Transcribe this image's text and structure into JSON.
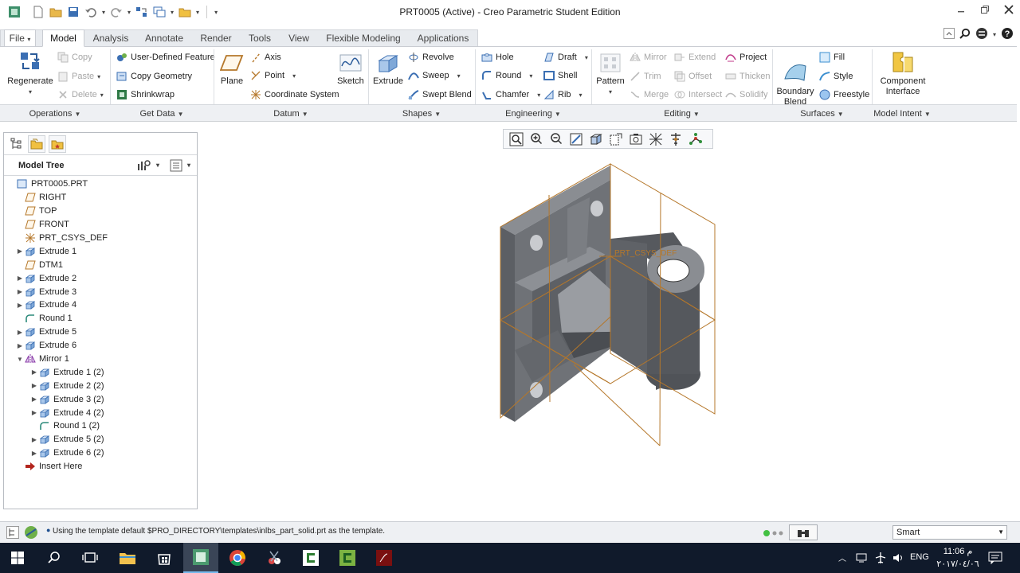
{
  "window": {
    "title": "PRT0005 (Active) - Creo Parametric Student Edition"
  },
  "tabs": [
    {
      "label": "File",
      "suffix": "▾"
    },
    {
      "label": "Model"
    },
    {
      "label": "Analysis"
    },
    {
      "label": "Annotate"
    },
    {
      "label": "Render"
    },
    {
      "label": "Tools"
    },
    {
      "label": "View"
    },
    {
      "label": "Flexible Modeling"
    },
    {
      "label": "Applications"
    }
  ],
  "ribbon": {
    "operations": {
      "regenerate": "Regenerate",
      "copy": "Copy",
      "paste": "Paste",
      "delete": "Delete",
      "group": "Operations"
    },
    "getdata": {
      "udf": "User-Defined Feature",
      "copy_geometry": "Copy Geometry",
      "shrinkwrap": "Shrinkwrap",
      "group": "Get Data"
    },
    "datum": {
      "plane": "Plane",
      "axis": "Axis",
      "point": "Point",
      "csys": "Coordinate System",
      "sketch": "Sketch",
      "group": "Datum"
    },
    "shapes": {
      "extrude": "Extrude",
      "revolve": "Revolve",
      "sweep": "Sweep",
      "swept_blend": "Swept Blend",
      "group": "Shapes"
    },
    "engineering": {
      "hole": "Hole",
      "round": "Round",
      "chamfer": "Chamfer",
      "draft": "Draft",
      "shell": "Shell",
      "rib": "Rib",
      "group": "Engineering"
    },
    "editing": {
      "pattern": "Pattern",
      "mirror": "Mirror",
      "trim": "Trim",
      "merge": "Merge",
      "extend": "Extend",
      "offset": "Offset",
      "intersect": "Intersect",
      "project": "Project",
      "thicken": "Thicken",
      "solidify": "Solidify",
      "group": "Editing"
    },
    "surfaces": {
      "boundary_blend": "Boundary\nBlend",
      "fill": "Fill",
      "style": "Style",
      "freestyle": "Freestyle",
      "group": "Surfaces"
    },
    "modelintent": {
      "component_interface": "Component\nInterface",
      "group": "Model Intent"
    }
  },
  "model_tree": {
    "title": "Model Tree",
    "items": [
      {
        "label": "PRT0005.PRT",
        "icon": "part-icon",
        "level": 0,
        "expander": ""
      },
      {
        "label": "RIGHT",
        "icon": "datum-plane-icon",
        "level": 1,
        "expander": ""
      },
      {
        "label": "TOP",
        "icon": "datum-plane-icon",
        "level": 1,
        "expander": ""
      },
      {
        "label": "FRONT",
        "icon": "datum-plane-icon",
        "level": 1,
        "expander": ""
      },
      {
        "label": "PRT_CSYS_DEF",
        "icon": "csys-icon",
        "level": 1,
        "expander": ""
      },
      {
        "label": "Extrude 1",
        "icon": "extrude-icon",
        "level": 1,
        "expander": "▶"
      },
      {
        "label": "DTM1",
        "icon": "datum-plane-icon",
        "level": 1,
        "expander": ""
      },
      {
        "label": "Extrude 2",
        "icon": "extrude-icon",
        "level": 1,
        "expander": "▶"
      },
      {
        "label": "Extrude 3",
        "icon": "extrude-icon",
        "level": 1,
        "expander": "▶"
      },
      {
        "label": "Extrude 4",
        "icon": "extrude-icon",
        "level": 1,
        "expander": "▶"
      },
      {
        "label": "Round 1",
        "icon": "round-icon",
        "level": 1,
        "expander": ""
      },
      {
        "label": "Extrude 5",
        "icon": "extrude-icon",
        "level": 1,
        "expander": "▶"
      },
      {
        "label": "Extrude 6",
        "icon": "extrude-icon",
        "level": 1,
        "expander": "▶"
      },
      {
        "label": "Mirror 1",
        "icon": "mirror-icon",
        "level": 1,
        "expander": "▼"
      },
      {
        "label": "Extrude 1 (2)",
        "icon": "extrude-icon",
        "level": 2,
        "expander": "▶"
      },
      {
        "label": "Extrude 2 (2)",
        "icon": "extrude-icon",
        "level": 2,
        "expander": "▶"
      },
      {
        "label": "Extrude 3 (2)",
        "icon": "extrude-icon",
        "level": 2,
        "expander": "▶"
      },
      {
        "label": "Extrude 4 (2)",
        "icon": "extrude-icon",
        "level": 2,
        "expander": "▶"
      },
      {
        "label": "Round 1 (2)",
        "icon": "round-icon",
        "level": 2,
        "expander": ""
      },
      {
        "label": "Extrude 5 (2)",
        "icon": "extrude-icon",
        "level": 2,
        "expander": "▶"
      },
      {
        "label": "Extrude 6 (2)",
        "icon": "extrude-icon",
        "level": 2,
        "expander": "▶"
      },
      {
        "label": "Insert Here",
        "icon": "insert-here-icon",
        "level": 1,
        "expander": ""
      }
    ]
  },
  "canvas": {
    "csys_label": "PRT_CSYS_DEF"
  },
  "status": {
    "message": "Using the template default $PRO_DIRECTORY\\templates\\inlbs_part_solid.prt as the template.",
    "filter": "Smart"
  },
  "taskbar": {
    "lang": "ENG",
    "time": "11:06 م",
    "date": "٢٠١٧/٠٤/٠٦"
  },
  "colors": {
    "accent": "#2f6fb5",
    "datum": "#b5772a",
    "solid": "#6b6e73"
  }
}
